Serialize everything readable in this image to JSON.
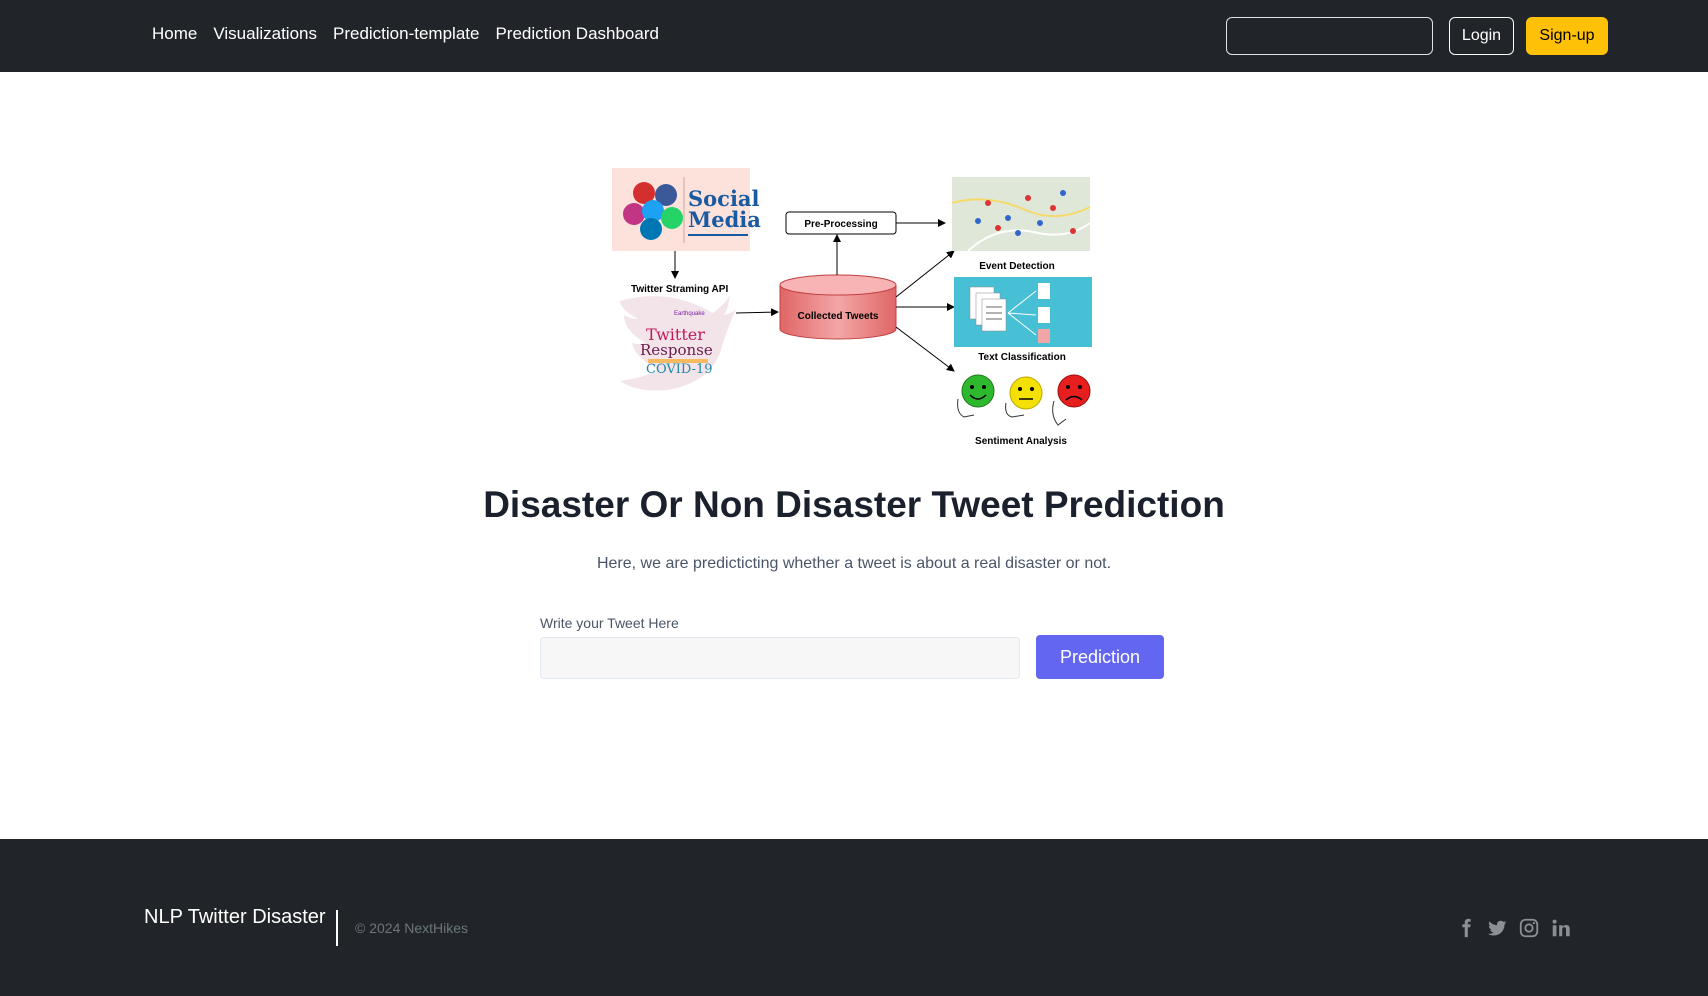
{
  "nav": {
    "links": [
      "Home",
      "Visualizations",
      "Prediction-template",
      "Prediction Dashboard"
    ],
    "search_value": "",
    "login_label": "Login",
    "signup_label": "Sign-up"
  },
  "diagram": {
    "social_title_1": "Social",
    "social_title_2": "Media",
    "stream_label": "Twitter Straming API",
    "db_label": "Collected Tweets",
    "preprocess_label": "Pre-Processing",
    "event_label": "Event Detection",
    "text_class_label": "Text Classification",
    "sentiment_label": "Sentiment Analysis",
    "cloud_words": [
      "Twitter",
      "Response",
      "COVID-19",
      "Earthquake"
    ]
  },
  "main": {
    "title": "Disaster Or Non Disaster Tweet Prediction",
    "subtitle": "Here, we are predicticting whether a tweet is about a real disaster or not.",
    "input_label": "Write your Tweet Here",
    "input_value": "",
    "predict_label": "Prediction"
  },
  "footer": {
    "brand": "NLP Twitter Disaster",
    "copyright": "© 2024 NextHikes",
    "social_icons": [
      "facebook-icon",
      "twitter-icon",
      "instagram-icon",
      "linkedin-icon"
    ]
  },
  "colors": {
    "navbar_bg": "#212529",
    "signup_bg": "#ffc107",
    "predict_bg": "#6366f1",
    "footer_bg": "#212529"
  }
}
